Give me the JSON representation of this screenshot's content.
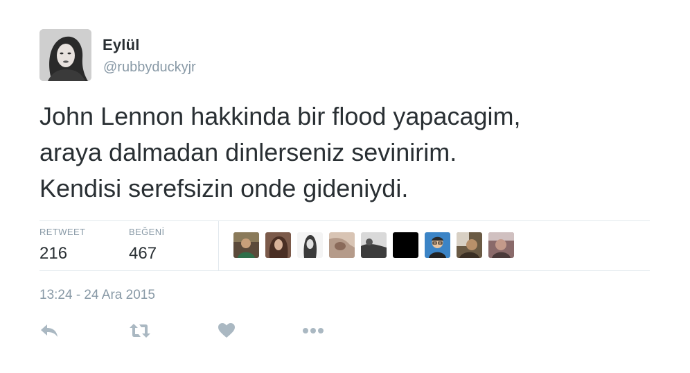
{
  "author": {
    "display_name": "Eylül",
    "handle": "@rubbyduckyjr",
    "avatar_icon": "profile-photo"
  },
  "tweet": {
    "text": "John Lennon hakkinda bir flood yapacagim,\naraya dalmadan dinlerseniz sevinirim.\nKendisi serefsizin onde gideniydi.",
    "timestamp": "13:24 - 24 Ara 2015"
  },
  "stats": {
    "retweet_label": "RETWEET",
    "retweet_count": "216",
    "like_label": "BEĞENİ",
    "like_count": "467"
  },
  "likers": [
    {
      "icon": "avatar-liker-1",
      "color": "#5b4a3a"
    },
    {
      "icon": "avatar-liker-2",
      "color": "#7b5a4a"
    },
    {
      "icon": "avatar-liker-3",
      "color": "#e9e9e9"
    },
    {
      "icon": "avatar-liker-4",
      "color": "#b59b8a"
    },
    {
      "icon": "avatar-liker-5",
      "color": "#3c3c3c"
    },
    {
      "icon": "avatar-liker-6",
      "color": "#000000"
    },
    {
      "icon": "avatar-liker-7",
      "color": "#3b84c6"
    },
    {
      "icon": "avatar-liker-8",
      "color": "#6a5a44"
    },
    {
      "icon": "avatar-liker-9",
      "color": "#8a6a6a"
    }
  ],
  "actions": {
    "reply_icon": "reply-icon",
    "retweet_icon": "retweet-icon",
    "like_icon": "heart-icon",
    "more_icon": "more-icon"
  },
  "colors": {
    "text": "#292f33",
    "secondary": "#8899a6",
    "divider": "#e1e8ed",
    "icon": "#aab8c2"
  }
}
